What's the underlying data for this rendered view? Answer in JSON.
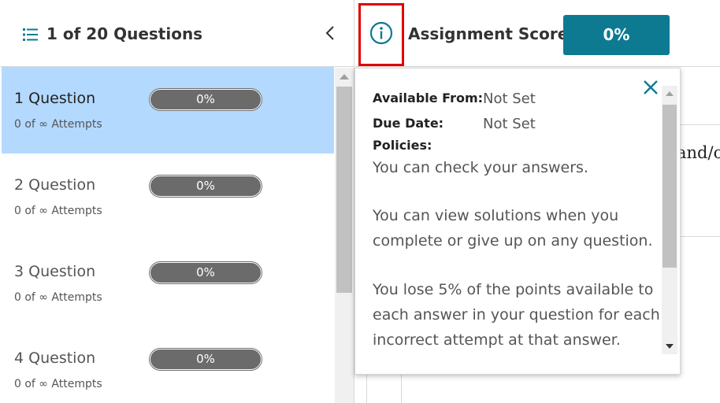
{
  "sidebar": {
    "title": "1 of 20 Questions",
    "questions": [
      {
        "label": "1 Question",
        "attempts": "0 of ∞ Attempts",
        "progress": "0%",
        "selected": true
      },
      {
        "label": "2 Question",
        "attempts": "0 of ∞ Attempts",
        "progress": "0%",
        "selected": false
      },
      {
        "label": "3 Question",
        "attempts": "0 of ∞ Attempts",
        "progress": "0%",
        "selected": false
      },
      {
        "label": "4 Question",
        "attempts": "0 of ∞ Attempts",
        "progress": "0%",
        "selected": false
      }
    ]
  },
  "header": {
    "score_label": "Assignment Score:",
    "score_value": "0%"
  },
  "background": {
    "partial_text": "and/o"
  },
  "info_popover": {
    "available_from_label": "Available From:",
    "available_from_value": "Not Set",
    "due_date_label": "Due Date:",
    "due_date_value": "Not Set",
    "policies_label": "Policies:",
    "policies": [
      "You can check your answers.",
      "You can view solutions when you complete or give up on any question.",
      "You lose 5% of the points available to each answer in your question for each incorrect attempt at that answer."
    ]
  },
  "icons": {
    "list": "list-icon",
    "collapse": "chevron-left-icon",
    "info": "info-icon",
    "close": "close-icon"
  },
  "colors": {
    "accent": "#0d7a92",
    "selected_row": "#b3d9ff",
    "progress_pill": "#6b6b6b",
    "highlight_border": "#e00000"
  }
}
